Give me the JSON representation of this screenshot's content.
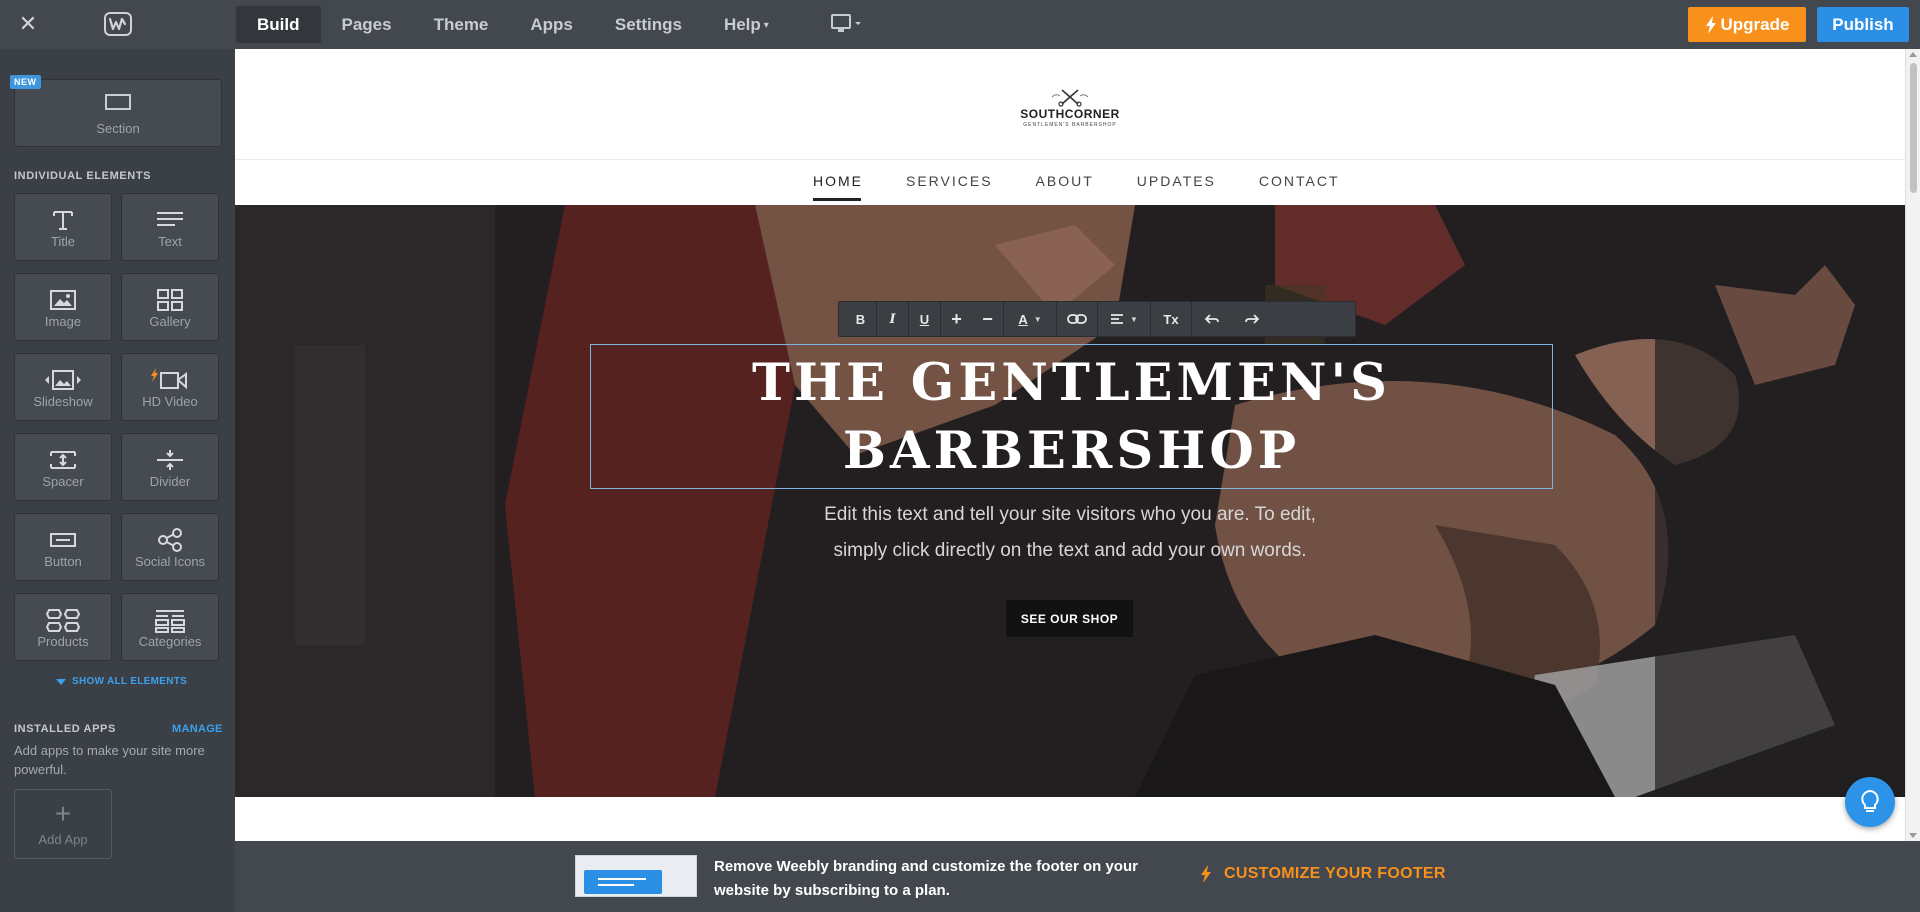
{
  "topbar": {
    "tabs": [
      {
        "label": "Build"
      },
      {
        "label": "Pages"
      },
      {
        "label": "Theme"
      },
      {
        "label": "Apps"
      },
      {
        "label": "Settings"
      },
      {
        "label": "Help"
      }
    ],
    "upgrade_label": "Upgrade",
    "publish_label": "Publish"
  },
  "sidebar": {
    "new_badge": "NEW",
    "section_label": "Section",
    "elements_heading": "INDIVIDUAL ELEMENTS",
    "elements": [
      {
        "label": "Title",
        "icon": "title-icon"
      },
      {
        "label": "Text",
        "icon": "text-icon"
      },
      {
        "label": "Image",
        "icon": "image-icon"
      },
      {
        "label": "Gallery",
        "icon": "gallery-icon"
      },
      {
        "label": "Slideshow",
        "icon": "slideshow-icon"
      },
      {
        "label": "HD Video",
        "icon": "video-icon"
      },
      {
        "label": "Spacer",
        "icon": "spacer-icon"
      },
      {
        "label": "Divider",
        "icon": "divider-icon"
      },
      {
        "label": "Button",
        "icon": "button-icon"
      },
      {
        "label": "Social Icons",
        "icon": "share-icon"
      },
      {
        "label": "Products",
        "icon": "products-icon"
      },
      {
        "label": "Categories",
        "icon": "categories-icon"
      }
    ],
    "show_all_label": "SHOW ALL ELEMENTS",
    "apps_heading": "INSTALLED APPS",
    "manage_label": "MANAGE",
    "apps_description": "Add apps to make your site more powerful.",
    "add_app_label": "Add App"
  },
  "site": {
    "logo_text": "SOUTHCORNER",
    "logo_subtext": "GENTLEMEN'S BARBERSHOP",
    "nav": [
      {
        "label": "HOME"
      },
      {
        "label": "SERVICES"
      },
      {
        "label": "ABOUT"
      },
      {
        "label": "UPDATES"
      },
      {
        "label": "CONTACT"
      }
    ],
    "hero": {
      "title_line1": "THE GENTLEMEN'S",
      "title_line2": "BARBERSHOP",
      "subtitle_line1": "Edit this text and tell your site visitors who you are. To edit,",
      "subtitle_line2": "simply click directly on the text and add your own words.",
      "button_label": "SEE OUR SHOP"
    }
  },
  "editor_toolbar": {
    "bold": "B",
    "italic": "I",
    "underline": "U",
    "increase": "+",
    "decrease": "−",
    "color": "A",
    "clear_format": "Tx"
  },
  "footer_banner": {
    "text": "Remove Weebly branding and customize the footer on your website by subscribing to a plan.",
    "cta_label": "CUSTOMIZE YOUR FOOTER"
  },
  "colors": {
    "accent_orange": "#f8901c",
    "accent_blue": "#2b8fe6",
    "chrome_dark": "#43484e"
  }
}
